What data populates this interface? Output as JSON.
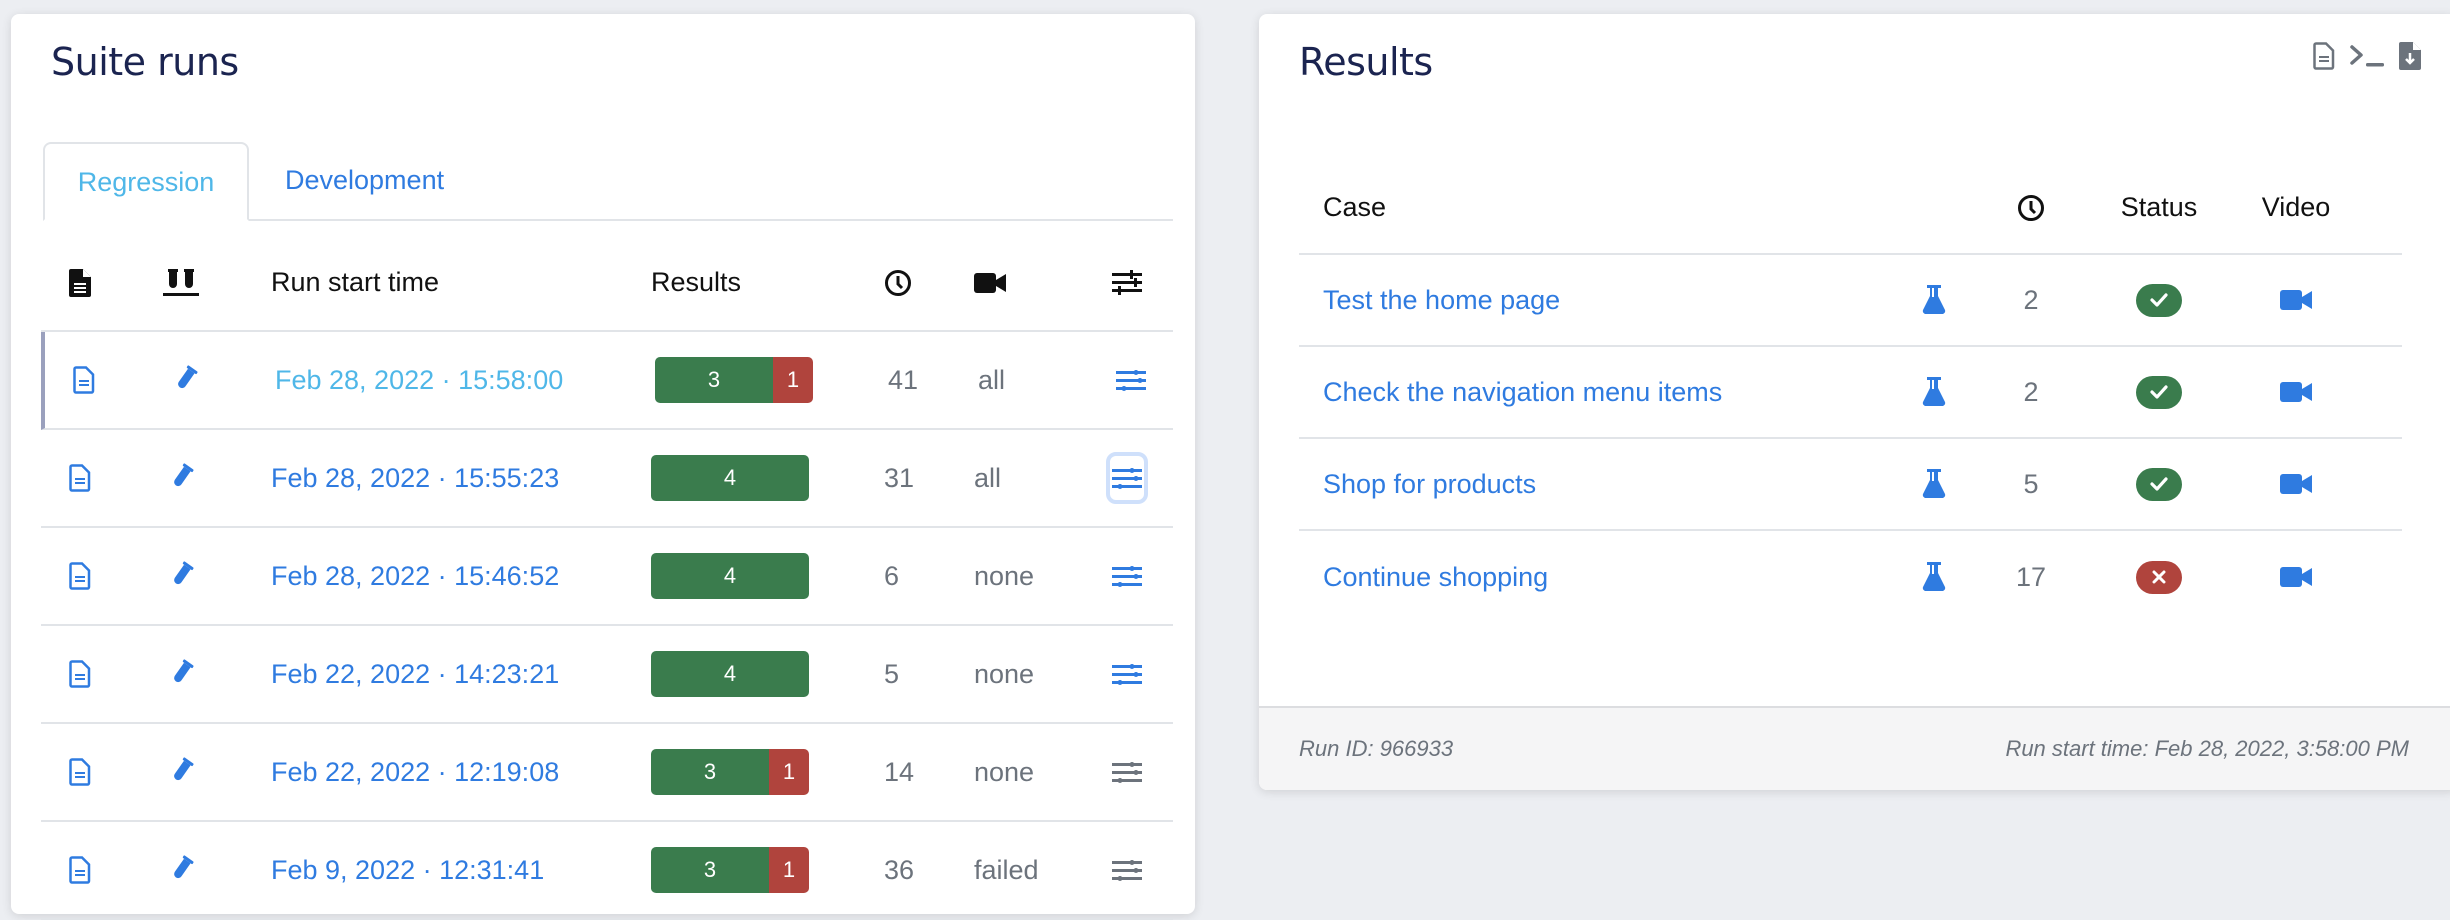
{
  "left": {
    "title": "Suite runs",
    "tabs": [
      {
        "label": "Regression",
        "active": true
      },
      {
        "label": "Development",
        "active": false
      }
    ],
    "columns": {
      "report_icon": "document-icon",
      "tests_icon": "test-tubes-icon",
      "run_start_time": "Run start time",
      "results": "Results",
      "duration_icon": "clock-icon",
      "video_icon": "video-camera-icon",
      "settings_icon": "sliders-icon"
    },
    "runs": [
      {
        "time": "Feb 28, 2022 · 15:58:00",
        "passed": "3",
        "failed": "1",
        "duration": "41",
        "video": "all",
        "selected": true,
        "settings_color": "#2f7be0"
      },
      {
        "time": "Feb 28, 2022 · 15:55:23",
        "passed": "4",
        "failed": "",
        "duration": "31",
        "video": "all",
        "focused": true,
        "settings_color": "#2f7be0"
      },
      {
        "time": "Feb 28, 2022 · 15:46:52",
        "passed": "4",
        "failed": "",
        "duration": "6",
        "video": "none",
        "settings_color": "#2f7be0"
      },
      {
        "time": "Feb 22, 2022 · 14:23:21",
        "passed": "4",
        "failed": "",
        "duration": "5",
        "video": "none",
        "settings_color": "#2f7be0"
      },
      {
        "time": "Feb 22, 2022 · 12:19:08",
        "passed": "3",
        "failed": "1",
        "duration": "14",
        "video": "none",
        "settings_color": "#6c737c"
      },
      {
        "time": "Feb 9, 2022 · 12:31:41",
        "passed": "3",
        "failed": "1",
        "duration": "36",
        "video": "failed",
        "settings_color": "#6c737c"
      }
    ]
  },
  "right": {
    "title": "Results",
    "header_icons": [
      "file-text-icon",
      "terminal-icon",
      "file-download-icon"
    ],
    "columns": {
      "case": "Case",
      "duration_icon": "clock-icon",
      "status": "Status",
      "video": "Video"
    },
    "cases": [
      {
        "name": "Test the home page",
        "duration": "2",
        "status": "passed"
      },
      {
        "name": "Check the navigation menu items",
        "duration": "2",
        "status": "passed"
      },
      {
        "name": "Shop for products",
        "duration": "5",
        "status": "passed"
      },
      {
        "name": "Continue shopping",
        "duration": "17",
        "status": "failed"
      }
    ],
    "footer": {
      "run_id": "Run ID: 966933",
      "run_start_time": "Run start time: Feb 28, 2022, 3:58:00 PM"
    }
  },
  "colors": {
    "link": "#2f7be0",
    "active_tab": "#4fb7e8",
    "pass": "#3a7c4d",
    "fail": "#b0443d",
    "muted": "#6c737c",
    "title": "#1b2450"
  }
}
